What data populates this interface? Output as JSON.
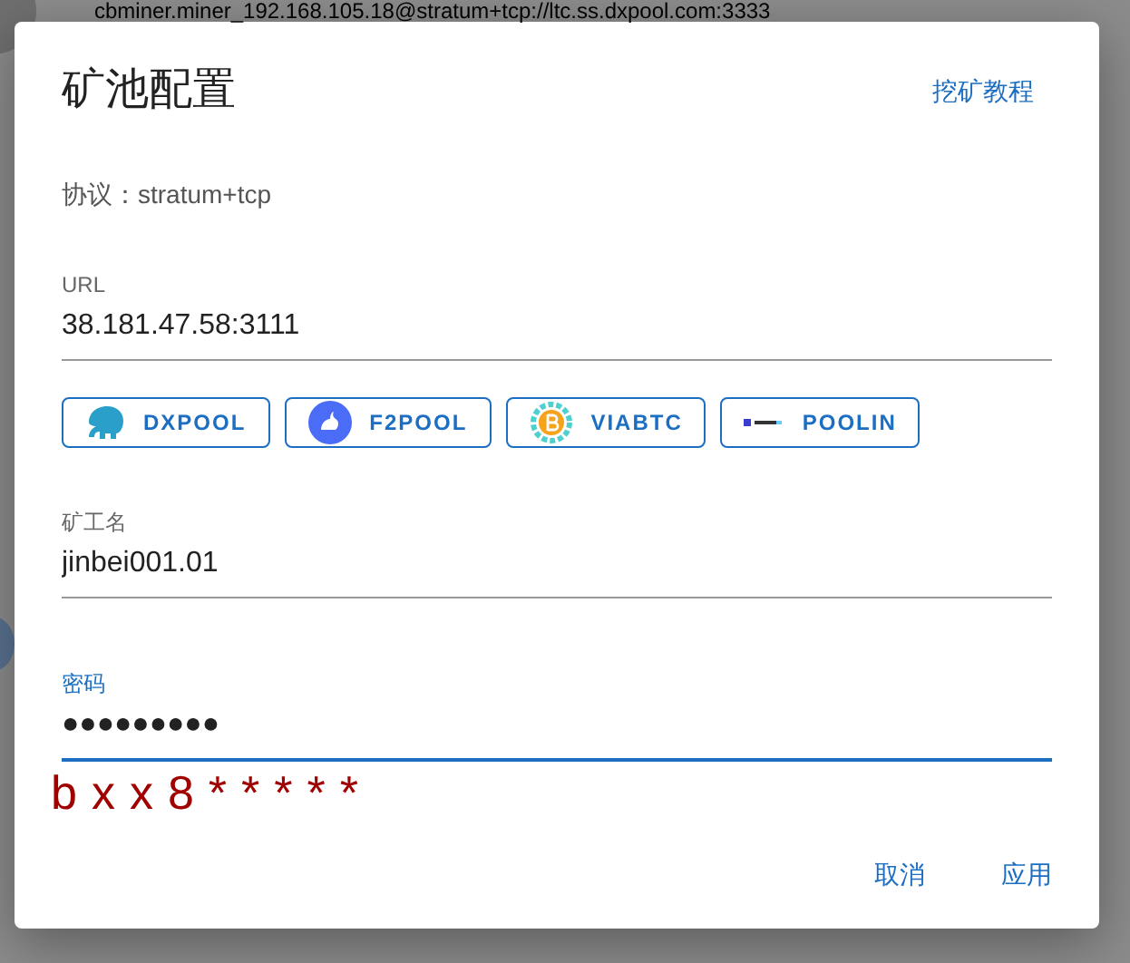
{
  "background": {
    "text": "cbminer.miner_192.168.105.18@stratum+tcp://ltc.ss.dxpool.com:3333"
  },
  "dialog": {
    "title": "矿池配置",
    "help_link": "挖矿教程",
    "protocol": "协议：stratum+tcp",
    "fields": [
      {
        "label": "URL",
        "value": "38.181.47.58:3111",
        "focused": false,
        "kind": "text"
      },
      {
        "kind": "pools",
        "pools": [
          {
            "label": "DXPOOL",
            "kind": "dxpool"
          },
          {
            "label": "F2POOL",
            "kind": "f2pool"
          },
          {
            "label": "VIABTC",
            "kind": "viabtc"
          },
          {
            "label": "POOLIN",
            "kind": "poolin"
          }
        ]
      },
      {
        "label": "矿工名",
        "value": "jinbei001.01",
        "focused": false,
        "kind": "text"
      },
      {
        "label": "密码",
        "value": "●●●●●●●●●",
        "focused": true,
        "kind": "text"
      }
    ],
    "note": "bxx8*****",
    "buttons": [
      "取消",
      "应用"
    ]
  }
}
